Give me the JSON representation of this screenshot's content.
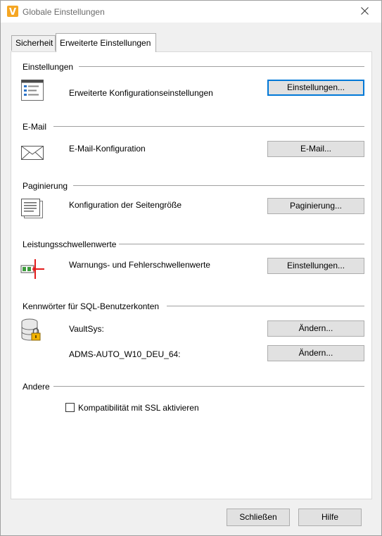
{
  "window": {
    "title": "Globale Einstellungen"
  },
  "tabs": [
    {
      "label": "Sicherheit",
      "selected": false
    },
    {
      "label": "Erweiterte Einstellungen",
      "selected": true
    }
  ],
  "groups": {
    "settings": {
      "title": "Einstellungen",
      "description": "Erweiterte Konfigurationseinstellungen",
      "button": "Einstellungen...",
      "icon": "settings-list-icon"
    },
    "email": {
      "title": "E-Mail",
      "description": "E-Mail-Konfiguration",
      "button": "E-Mail...",
      "icon": "envelope-icon"
    },
    "paging": {
      "title": "Paginierung",
      "description": "Konfiguration der Seitengröße",
      "button": "Paginierung...",
      "icon": "document-pages-icon"
    },
    "thresholds": {
      "title": "Leistungsschwellenwerte",
      "description": "Warnungs- und Fehlerschwellenwerte",
      "button": "Einstellungen...",
      "icon": "threshold-icon"
    },
    "sql": {
      "title": "Kennwörter für SQL-Benutzerkonten",
      "icon": "database-lock-icon",
      "accounts": [
        {
          "name": "VaultSys:",
          "button": "Ändern..."
        },
        {
          "name": "ADMS-AUTO_W10_DEU_64:",
          "button": "Ändern..."
        }
      ]
    },
    "other": {
      "title": "Andere",
      "ssl_label": "Kompatibilität mit SSL aktivieren",
      "ssl_checked": false
    }
  },
  "footer": {
    "close": "Schließen",
    "help": "Hilfe"
  },
  "colors": {
    "accent": "#0078d7",
    "icon_orange": "#f5a623",
    "threshold_red": "#e31c1c",
    "threshold_green": "#3c9b3c"
  }
}
